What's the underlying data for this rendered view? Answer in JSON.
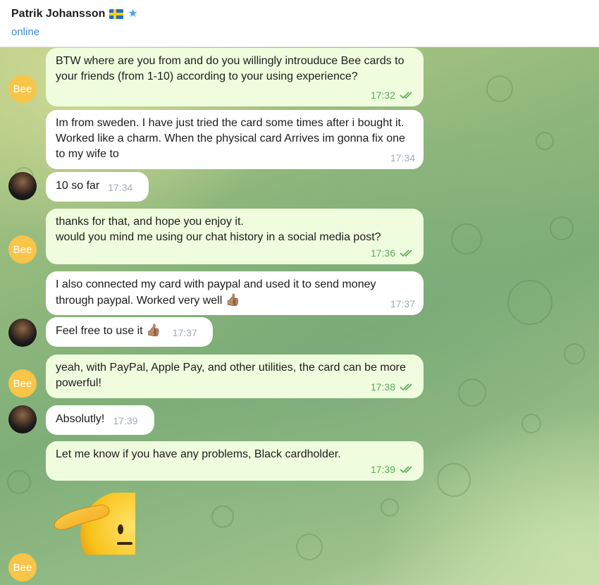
{
  "header": {
    "contact_name": "Patrik Johansson",
    "status": "online"
  },
  "avatar_labels": {
    "bee": "Bee"
  },
  "messages": [
    {
      "text": "BTW where are you from and do you willingly introuduce Bee cards to your friends (from 1-10) according to your using experience?",
      "time": "17:32"
    },
    {
      "text": "Im from sweden. I have just tried the card some times after i bought it. Worked like a charm. When the physical card Arrives im gonna fix one to my wife to",
      "time": "17:34"
    },
    {
      "text": "10 so far",
      "time": "17:34"
    },
    {
      "line1": "thanks for that, and hope you enjoy it.",
      "line2": "would you mind me using our chat history in a social media post?",
      "time": "17:36"
    },
    {
      "text": "I also connected my card with paypal and used it to send money through paypal. Worked very well",
      "emoji": "👍🏽",
      "time": "17:37"
    },
    {
      "text": "Feel free to use it",
      "emoji": "👍🏽",
      "time": "17:37"
    },
    {
      "text": "yeah, with PayPal, Apple Pay, and other utilities, the card can be more powerful!",
      "time": "17:38"
    },
    {
      "text": "Absolutly!",
      "time": "17:39"
    },
    {
      "text": "Let me know if you have any problems, Black cardholder.",
      "time": "17:39"
    }
  ],
  "sticker": "saluting-face-emoji"
}
